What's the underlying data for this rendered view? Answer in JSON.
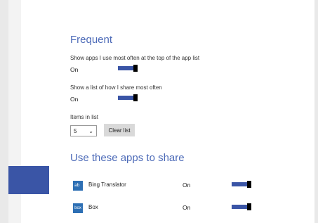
{
  "frequent": {
    "title": "Frequent",
    "setting1_label": "Show apps I use most often at the top of the app list",
    "setting1_state": "On",
    "setting2_label": "Show a list of how I share most often",
    "setting2_state": "On",
    "items_label": "Items in list",
    "items_value": "5",
    "clear_button": "Clear list"
  },
  "share": {
    "title": "Use these apps to share",
    "apps": [
      {
        "name": "Bing Translator",
        "state": "On",
        "icon": "translator-icon"
      },
      {
        "name": "Box",
        "state": "On",
        "icon_text": "box",
        "icon": "box-icon"
      }
    ]
  },
  "colors": {
    "accent": "#3a55a6",
    "title": "#4d6bb8"
  }
}
